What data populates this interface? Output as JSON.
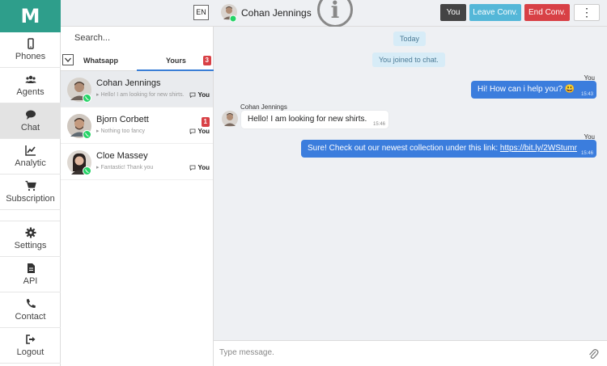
{
  "app": {
    "logo": "M",
    "brand_color": "#2e9e8b"
  },
  "sidebar": {
    "items": [
      {
        "label": "Phones",
        "icon": "phone-icon"
      },
      {
        "label": "Agents",
        "icon": "users-icon"
      },
      {
        "label": "Chat",
        "icon": "chat-icon",
        "active": true
      },
      {
        "label": "Analytic",
        "icon": "chart-icon"
      },
      {
        "label": "Subscription",
        "icon": "cart-icon"
      },
      {
        "label": "Settings",
        "icon": "gear-icon"
      },
      {
        "label": "API",
        "icon": "file-icon"
      },
      {
        "label": "Contact",
        "icon": "phone-handset-icon"
      },
      {
        "label": "Logout",
        "icon": "logout-icon"
      }
    ]
  },
  "header": {
    "lang": "EN",
    "contact_name": "Cohan Jennings",
    "buttons": {
      "you": "You",
      "leave": "Leave Conv.",
      "end": "End Conv.",
      "more": "⋮"
    }
  },
  "chatlist": {
    "search_placeholder": "Search...",
    "tabs": {
      "whatsapp": "Whatsapp",
      "yours": "Yours",
      "yours_count": "3"
    },
    "chats": [
      {
        "name": "Cohan Jennings",
        "preview": "Hello! I am looking for new shirts.",
        "owner": "You",
        "unread": ""
      },
      {
        "name": "Bjorn Corbett",
        "preview": "Nothing too fancy",
        "owner": "You",
        "unread": "1"
      },
      {
        "name": "Cloe Massey",
        "preview": "Fantastic! Thank you",
        "owner": "You",
        "unread": ""
      }
    ]
  },
  "conversation": {
    "today": "Today",
    "joined": "You joined to chat.",
    "messages": [
      {
        "sender": "You",
        "text": "Hi! How can i help you? 😃",
        "time": "15:43",
        "direction": "out"
      },
      {
        "sender": "Cohan Jennings",
        "text": "Hello! I am looking for new shirts.",
        "time": "15:46",
        "direction": "in"
      },
      {
        "sender": "You",
        "text": "Sure! Check out our newest collection under this link: ",
        "link": "https://bit.ly/2WStumr",
        "time": "15:46",
        "direction": "out"
      }
    ]
  },
  "composer": {
    "placeholder": "Type message."
  }
}
